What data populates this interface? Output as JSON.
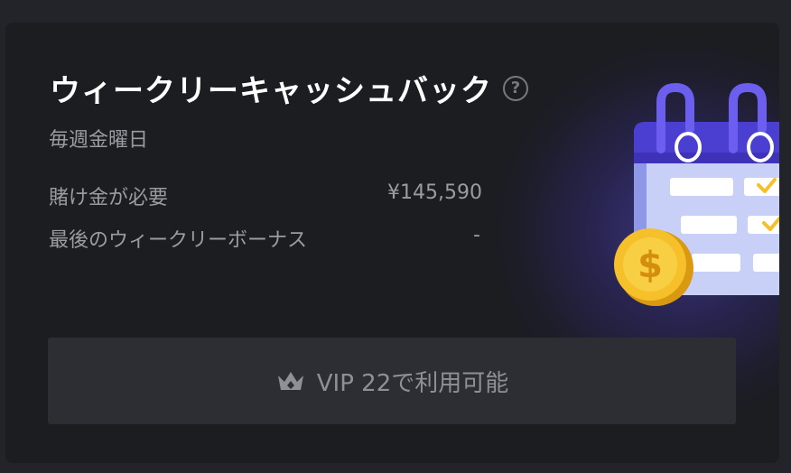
{
  "card": {
    "title": "ウィークリーキャッシュバック",
    "help_icon": "question-circle-icon",
    "subtitle": "毎週金曜日",
    "rows": [
      {
        "label": "賭け金が必要",
        "value": "¥145,590"
      },
      {
        "label": "最後のウィークリーボーナス",
        "value": "-"
      }
    ],
    "button": {
      "icon": "crown-icon",
      "label": "VIP 22で利用可能"
    },
    "illustration": "calendar-with-coin-illustration"
  },
  "colors": {
    "background": "#232429",
    "card": "#1c1d21",
    "button": "#2c2e33",
    "accent_purple": "#5b4fe0",
    "coin_gold": "#f5c02a"
  }
}
